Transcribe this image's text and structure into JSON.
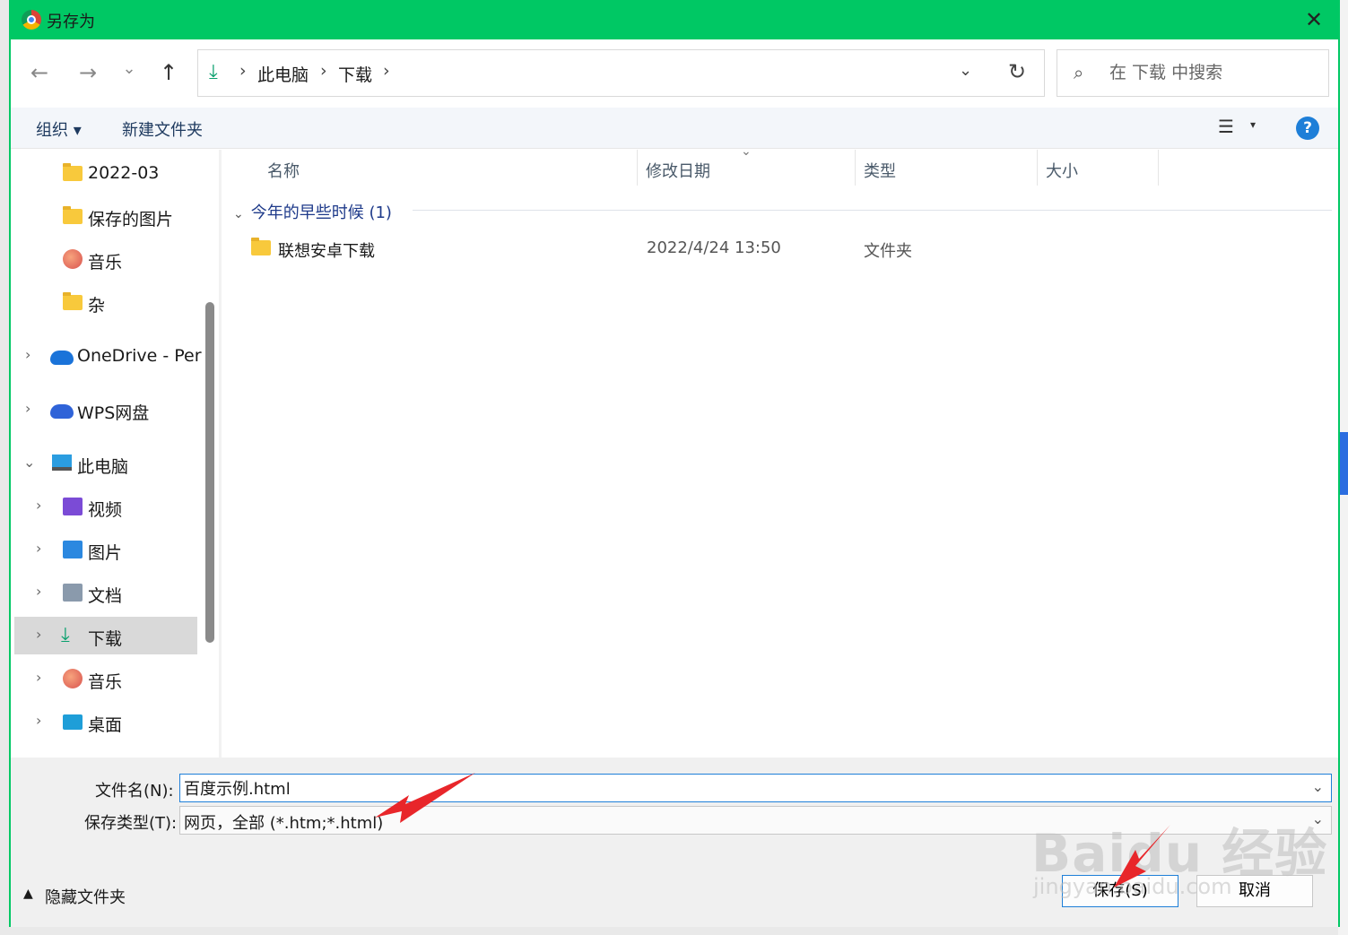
{
  "window": {
    "title": "另存为",
    "close_glyph": "✕"
  },
  "nav": {
    "back": "←",
    "forward": "→",
    "recent": "⌄",
    "up": "↑"
  },
  "address": {
    "crumbs": [
      "此电脑",
      "下载"
    ],
    "separator": "›",
    "dropdown_glyph": "⌄",
    "refresh_glyph": "↻"
  },
  "search": {
    "placeholder": "在 下载 中搜索"
  },
  "toolbar": {
    "organize": "组织 ▾",
    "new_folder": "新建文件夹",
    "view_glyph": "☰",
    "view_caret": "▾",
    "help": "?"
  },
  "sidebar": {
    "items": [
      {
        "label": "2022-03",
        "icon": "folder-icon"
      },
      {
        "label": "保存的图片",
        "icon": "folder-icon"
      },
      {
        "label": "音乐",
        "icon": "music-icon"
      },
      {
        "label": "杂",
        "icon": "folder-icon"
      },
      {
        "label": "OneDrive - Per",
        "icon": "onedrive-icon"
      },
      {
        "label": "WPS网盘",
        "icon": "wps-cloud-icon"
      },
      {
        "label": "此电脑",
        "icon": "computer-icon"
      },
      {
        "label": "视频",
        "icon": "video-icon"
      },
      {
        "label": "图片",
        "icon": "picture-icon"
      },
      {
        "label": "文档",
        "icon": "document-icon"
      },
      {
        "label": "下载",
        "icon": "download-icon",
        "selected": true
      },
      {
        "label": "音乐",
        "icon": "music-icon"
      },
      {
        "label": "桌面",
        "icon": "desktop-icon"
      }
    ],
    "collapsed_glyph": "›",
    "expanded_glyph": "⌄"
  },
  "columns": {
    "name": "名称",
    "modified": "修改日期",
    "type": "类型",
    "size": "大小"
  },
  "group": {
    "label": "今年的早些时候 (1)"
  },
  "files": [
    {
      "name": "联想安卓下载",
      "modified": "2022/4/24 13:50",
      "type": "文件夹",
      "size": ""
    }
  ],
  "form": {
    "filename_label": "文件名(N):",
    "filename_value": "百度示例.html",
    "filetype_label": "保存类型(T):",
    "filetype_value": "网页，全部 (*.htm;*.html)"
  },
  "footer": {
    "hide_folders": "隐藏文件夹",
    "save": "保存(S)",
    "cancel": "取消"
  },
  "watermark": {
    "brand": "Baidu 经验",
    "url": "jingyan.baidu.com"
  },
  "colors": {
    "titlebar": "#00c864",
    "accent": "#1e7fd8",
    "annotation_arrow": "#e8262a"
  }
}
